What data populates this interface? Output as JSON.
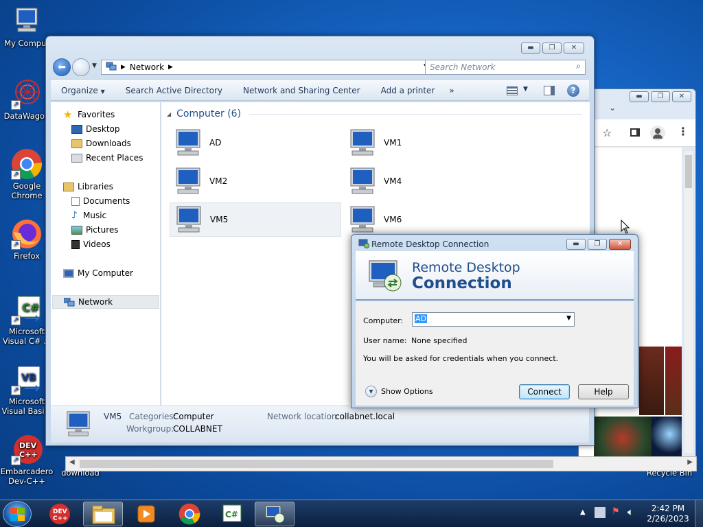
{
  "desktop": {
    "icons": [
      {
        "label": "My Comput",
        "icon": "computer-icon"
      },
      {
        "label": "DataWagon",
        "icon": "datawagon-icon"
      },
      {
        "label": "Google Chrome",
        "icon": "chrome-icon"
      },
      {
        "label": "Firefox",
        "icon": "firefox-icon"
      },
      {
        "label": "Microsoft Visual C# ...",
        "icon": "visual-csharp-icon"
      },
      {
        "label": "Microsoft Visual Basi...",
        "icon": "visual-basic-icon"
      },
      {
        "label": "Embarcadero Dev-C++",
        "icon": "devcpp-icon"
      },
      {
        "label": "download",
        "icon": "folder-icon"
      },
      {
        "label": "Recycle Bin",
        "icon": "recycle-bin-icon"
      }
    ]
  },
  "explorer": {
    "address": {
      "crumb": "Network",
      "search_placeholder": "Search Network"
    },
    "toolbar": {
      "organize": "Organize",
      "search_ad": "Search Active Directory",
      "network_center": "Network and Sharing Center",
      "add_printer": "Add a printer",
      "more": "»"
    },
    "nav": {
      "favorites": "Favorites",
      "desktop": "Desktop",
      "downloads": "Downloads",
      "recent": "Recent Places",
      "libraries": "Libraries",
      "documents": "Documents",
      "music": "Music",
      "pictures": "Pictures",
      "videos": "Videos",
      "my_computer": "My Computer",
      "network": "Network"
    },
    "group_header": "Computer (6)",
    "computers": [
      "AD",
      "VM1",
      "VM2",
      "VM4",
      "VM5",
      "VM6"
    ],
    "details": {
      "name": "VM5",
      "categories_label": "Categories:",
      "categories_value": "Computer",
      "workgroup_label": "Workgroup:",
      "workgroup_value": "COLLABNET",
      "network_location_label": "Network location:",
      "network_location_value": "collabnet.local"
    }
  },
  "rdc": {
    "title": "Remote Desktop Connection",
    "banner_line1": "Remote Desktop",
    "banner_line2": "Connection",
    "computer_label": "Computer:",
    "computer_value": "AD",
    "username_label": "User name:",
    "username_value": "None specified",
    "info": "You will be asked for credentials when you connect.",
    "show_options": "Show Options",
    "connect": "Connect",
    "help": "Help"
  },
  "taskbar": {
    "time": "2:42 PM",
    "date": "2/26/2023",
    "apps": [
      "start-orb-icon",
      "devcpp-icon",
      "explorer-icon",
      "media-player-icon",
      "chrome-icon",
      "visual-csharp-icon",
      "remote-desktop-icon"
    ]
  },
  "colors": {
    "accent": "#1e4e8c",
    "desktop_bg": "#1766c6"
  }
}
